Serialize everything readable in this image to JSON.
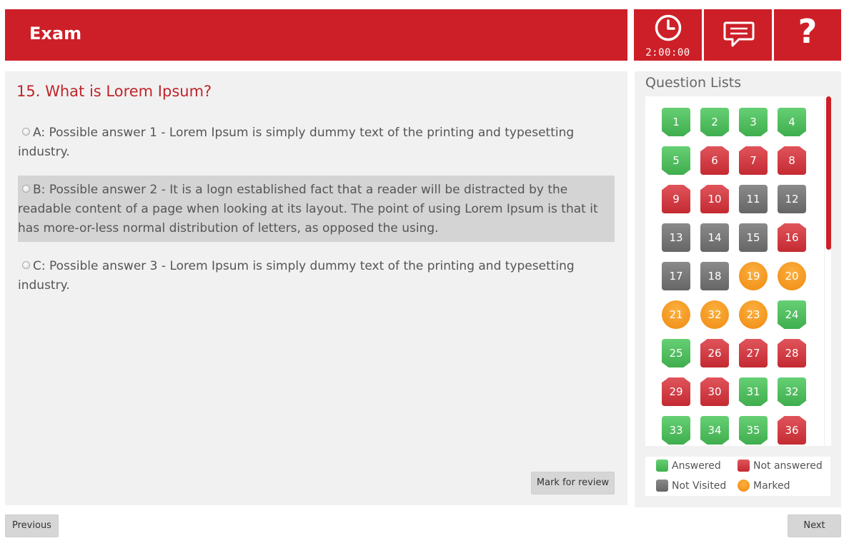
{
  "header": {
    "title": "Exam",
    "timer": "2:00:00",
    "timer_icon": "clock-icon",
    "chat_icon": "chat-icon",
    "help_icon": "help-icon",
    "help_glyph": "?",
    "color": "#cd1f27"
  },
  "question": {
    "number": "15",
    "text": "What is Lorem Ipsum?",
    "options": [
      {
        "letter": "A",
        "text": "Possible answer 1 - Lorem Ipsum is simply dummy text of the printing and typesetting industry.",
        "selected": false
      },
      {
        "letter": "B",
        "text": "Possible answer 2 - It is a logn established fact that a reader will be distracted by the readable content of a page when looking at its layout. The point of using Lorem Ipsum is that it has more-or-less normal distribution of letters, as opposed the using.",
        "selected": true
      },
      {
        "letter": "C",
        "text": "Possible answer 3 - Lorem Ipsum is simply dummy text of the printing and typesetting industry.",
        "selected": false
      }
    ],
    "mark_for_review_label": "Mark for review"
  },
  "navigation": {
    "previous_label": "Previous",
    "next_label": "Next"
  },
  "sidebar": {
    "title": "Question Lists",
    "questions": [
      {
        "label": "1",
        "status": "answered"
      },
      {
        "label": "2",
        "status": "answered"
      },
      {
        "label": "3",
        "status": "answered"
      },
      {
        "label": "4",
        "status": "answered"
      },
      {
        "label": "5",
        "status": "answered"
      },
      {
        "label": "6",
        "status": "not-answered"
      },
      {
        "label": "7",
        "status": "not-answered"
      },
      {
        "label": "8",
        "status": "not-answered"
      },
      {
        "label": "9",
        "status": "not-answered"
      },
      {
        "label": "10",
        "status": "not-answered"
      },
      {
        "label": "11",
        "status": "not-visited"
      },
      {
        "label": "12",
        "status": "not-visited"
      },
      {
        "label": "13",
        "status": "not-visited"
      },
      {
        "label": "14",
        "status": "not-visited"
      },
      {
        "label": "15",
        "status": "not-visited"
      },
      {
        "label": "16",
        "status": "not-answered"
      },
      {
        "label": "17",
        "status": "not-visited"
      },
      {
        "label": "18",
        "status": "not-visited"
      },
      {
        "label": "19",
        "status": "marked"
      },
      {
        "label": "20",
        "status": "marked"
      },
      {
        "label": "21",
        "status": "marked"
      },
      {
        "label": "32",
        "status": "marked"
      },
      {
        "label": "23",
        "status": "marked"
      },
      {
        "label": "24",
        "status": "answered"
      },
      {
        "label": "25",
        "status": "answered"
      },
      {
        "label": "26",
        "status": "not-answered"
      },
      {
        "label": "27",
        "status": "not-answered"
      },
      {
        "label": "28",
        "status": "not-answered"
      },
      {
        "label": "29",
        "status": "not-answered"
      },
      {
        "label": "30",
        "status": "not-answered"
      },
      {
        "label": "31",
        "status": "answered"
      },
      {
        "label": "32",
        "status": "answered"
      },
      {
        "label": "33",
        "status": "answered"
      },
      {
        "label": "34",
        "status": "answered"
      },
      {
        "label": "35",
        "status": "answered"
      },
      {
        "label": "36",
        "status": "not-answered"
      }
    ],
    "legend": {
      "answered": "Answered",
      "not_answered": "Not answered",
      "not_visited": "Not Visited",
      "marked": "Marked"
    },
    "colors": {
      "answered": "#4cbf5c",
      "not_answered": "#d2363e",
      "not_visited": "#777777",
      "marked": "#f5981f"
    }
  }
}
